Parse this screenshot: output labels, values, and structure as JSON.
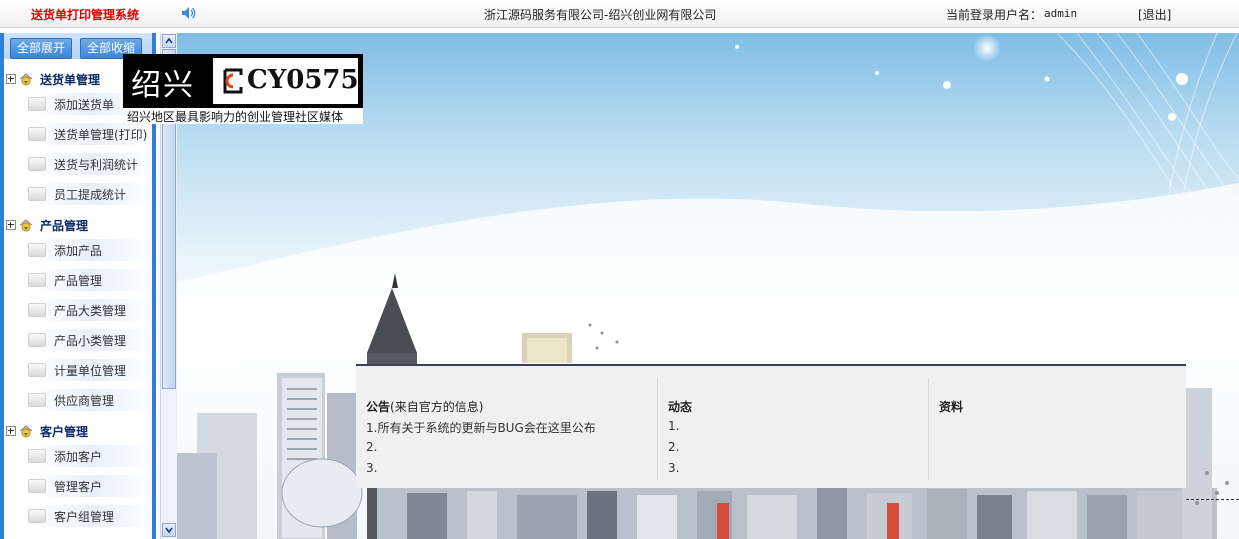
{
  "header": {
    "app_title": "送货单打印管理系统",
    "company": "浙江源码服务有限公司-绍兴创业网有限公司",
    "login_label": "当前登录用户名：",
    "username": "admin",
    "logout": "[退出]"
  },
  "sidebar": {
    "expand_all": "全部展开",
    "collapse_all": "全部收缩",
    "groups": [
      {
        "label": "送货单管理",
        "items": [
          "添加送货单",
          "送货单管理(打印)",
          "送货与利润统计",
          "员工提成统计"
        ]
      },
      {
        "label": "产品管理",
        "items": [
          "添加产品",
          "产品管理",
          "产品大类管理",
          "产品小类管理",
          "计量单位管理",
          "供应商管理"
        ]
      },
      {
        "label": "客户管理",
        "items": [
          "添加客户",
          "管理客户",
          "客户组管理"
        ]
      }
    ]
  },
  "logo": {
    "cn": "绍兴",
    "en": "CY0575",
    "slogan": "绍兴地区最具影响力的创业管理社区媒体"
  },
  "panel": {
    "notice": {
      "title": "公告",
      "subtitle": "(来自官方的信息)",
      "lines": [
        "1.所有关于系统的更新与BUG会在这里公布",
        "2.",
        "3."
      ]
    },
    "news": {
      "title": "动态",
      "lines": [
        "1.",
        "2.",
        "3."
      ]
    },
    "resources": {
      "title": "资料"
    }
  },
  "colors": {
    "title_red": "#e00000",
    "sidebar_blue": "#2f7fd6",
    "group_label": "#0a2a6a"
  }
}
